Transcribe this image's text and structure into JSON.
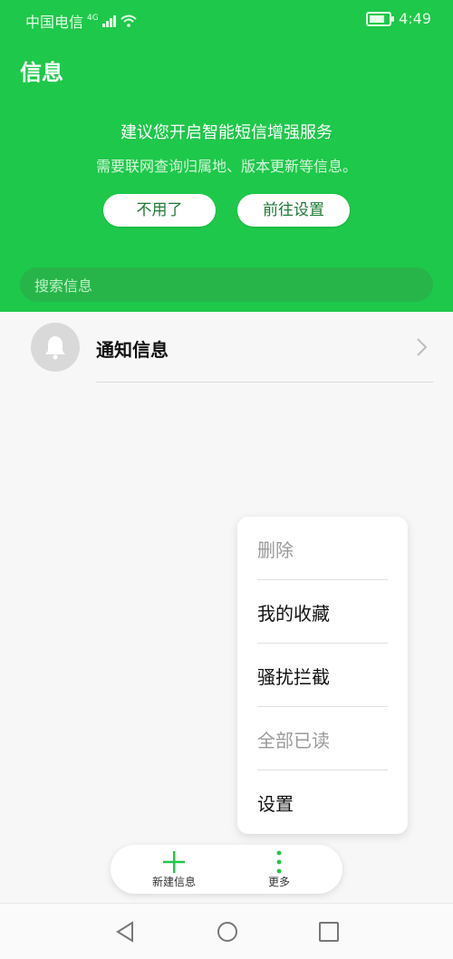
{
  "status_bar": {
    "carrier": "中国电信",
    "network": "4G",
    "time": "4:49"
  },
  "header": {
    "title": "信息"
  },
  "banner": {
    "headline": "建议您开启智能短信增强服务",
    "description": "需要联网查询归属地、版本更新等信息。",
    "decline_button": "不用了",
    "settings_button": "前往设置"
  },
  "search": {
    "placeholder": "搜索信息"
  },
  "conversations": [
    {
      "title": "通知信息",
      "icon": "bell-icon"
    }
  ],
  "overflow_menu": {
    "items": [
      {
        "label": "删除",
        "enabled": false
      },
      {
        "label": "我的收藏",
        "enabled": true
      },
      {
        "label": "骚扰拦截",
        "enabled": true
      },
      {
        "label": "全部已读",
        "enabled": false
      },
      {
        "label": "设置",
        "enabled": true
      }
    ]
  },
  "bottom_bar": {
    "new_message": "新建信息",
    "more": "更多"
  },
  "colors": {
    "accent": "#1ec84a",
    "disabled_text": "#9a9a9a"
  }
}
